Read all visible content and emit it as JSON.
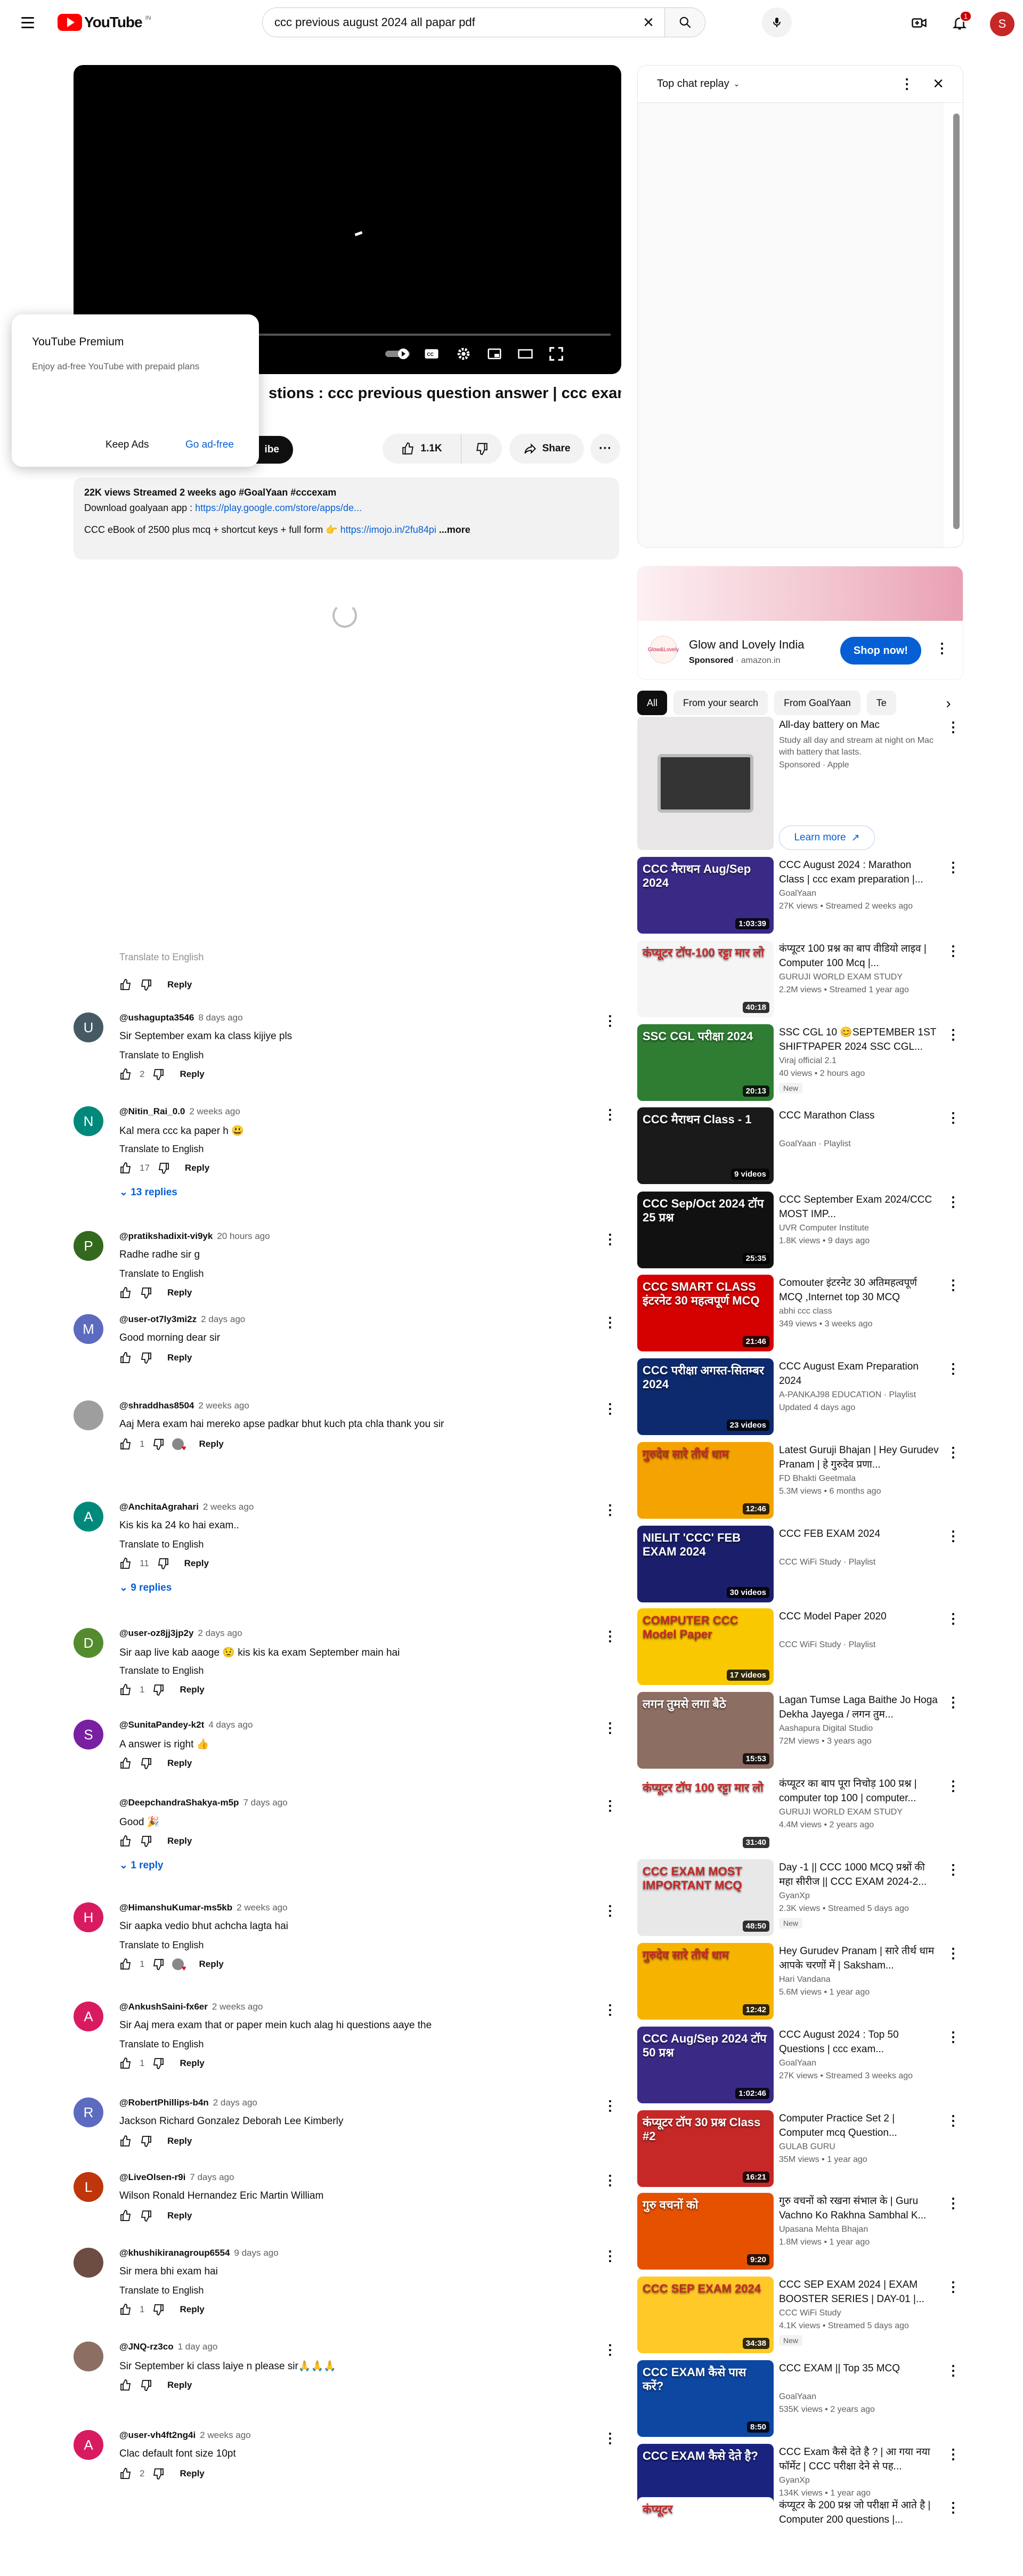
{
  "header": {
    "logo_text": "YouTube",
    "country": "IN",
    "search_value": "ccc previous august 2024 all papar pdf",
    "notification_count": "1",
    "avatar_letter": "S"
  },
  "premium": {
    "title": "YouTube Premium",
    "text": "Enjoy ad-free YouTube with prepaid plans",
    "keep": "Keep Ads",
    "go": "Go ad-free"
  },
  "video": {
    "title": "stions : ccc previous question answer | ccc exam",
    "subscribe": "ibe",
    "likes": "1.1K",
    "share": "Share",
    "desc_meta": "22K views  Streamed 2 weeks ago ",
    "desc_tags": "#GoalYaan #cccexam",
    "desc_line2_prefix": "Download goalyaan app : ",
    "desc_link1": "https://play.google.com/store/apps/de...",
    "desc_line3_prefix": "CCC eBook of 2500 plus mcq + shortcut keys + full form 👉 ",
    "desc_link2": "https://imojo.in/2fu84pi",
    "desc_more": "...more"
  },
  "chat": {
    "title": "Top chat replay"
  },
  "ad": {
    "title": "Glow and Lovely India",
    "sponsored": "Sponsored",
    "domain": "amazon.in",
    "shop": "Shop now!",
    "logo": "Glow&Lovely"
  },
  "chips": [
    "All",
    "From your search",
    "From GoalYaan",
    "Te"
  ],
  "recs": [
    {
      "title": "All-day battery on Mac",
      "channel": "Study all day and stream at night on Mac with battery that lasts.",
      "meta": "Sponsored · Apple",
      "duration": "",
      "thumb": "",
      "bg": "#e8e6e6",
      "learn": "Learn more"
    },
    {
      "title": "CCC August 2024 : Marathon Class | ccc exam preparation |...",
      "channel": "GoalYaan",
      "meta": "27K views • Streamed 2 weeks ago",
      "duration": "1:03:39",
      "thumb": "CCC मैराथन Aug/Sep 2024",
      "bg": "#3a2a86"
    },
    {
      "title": "कंप्यूटर 100 प्रश्न का बाप वीडियो लाइव | Computer 100 Mcq |...",
      "channel": "GURUJI WORLD EXAM STUDY",
      "meta": "2.2M views • Streamed 1 year ago",
      "duration": "40:18",
      "thumb": "कंप्यूटर टॉप-100 रट्टा मार लो",
      "bg": "#f5f5f5"
    },
    {
      "title": "SSC CGL 10 😊SEPTEMBER 1ST SHIFTPAPER 2024 SSC CGL...",
      "channel": "Viraj official 2.1",
      "meta": "40 views • 2 hours ago",
      "duration": "20:13",
      "thumb": "SSC CGL परीक्षा 2024",
      "bg": "#2e7d32",
      "new": "New"
    },
    {
      "title": "CCC Marathon Class",
      "channel": "GoalYaan · Playlist",
      "meta": "",
      "duration": "9 videos",
      "thumb": "CCC मैराथन Class - 1",
      "bg": "#1a1a1a"
    },
    {
      "title": "CCC September Exam 2024/CCC MOST IMP...",
      "channel": "UVR Computer Institute",
      "meta": "1.8K views • 9 days ago",
      "duration": "25:35",
      "thumb": "CCC Sep/Oct 2024 टॉप 25 प्रश्न",
      "bg": "#111"
    },
    {
      "title": "Comouter इंटरनेट 30 अतिमहत्वपूर्ण MCQ ,Internet top 30 MCQ",
      "channel": "abhi ccc class",
      "meta": "349 views • 3 weeks ago",
      "duration": "21:46",
      "thumb": "CCC SMART CLASS इंटरनेट 30 महत्वपूर्ण MCQ",
      "bg": "#d50000"
    },
    {
      "title": "CCC August Exam Preparation 2024",
      "channel": "A-PANKAJ98 EDUCATION · Playlist",
      "meta": "Updated 4 days ago",
      "duration": "23 videos",
      "thumb": "CCC परीक्षा अगस्त-सितम्बर 2024",
      "bg": "#0d2a6e"
    },
    {
      "title": "Latest Guruji Bhajan | Hey Gurudev Pranam | हे गुरुदेव प्रणा...",
      "channel": "FD Bhakti Geetmala",
      "meta": "5.3M views • 6 months ago",
      "duration": "12:46",
      "thumb": "गुरुदेव सारे तीर्थ धाम",
      "bg": "#f4a300"
    },
    {
      "title": "CCC FEB EXAM 2024",
      "channel": "CCC WiFi Study · Playlist",
      "meta": "",
      "duration": "30 videos",
      "thumb": "NIELIT 'CCC' FEB EXAM 2024",
      "bg": "#1b1f6b"
    },
    {
      "title": "CCC Model Paper 2020",
      "channel": "CCC WiFi Study · Playlist",
      "meta": "",
      "duration": "17 videos",
      "thumb": "COMPUTER CCC Model Paper",
      "bg": "#f9c800"
    },
    {
      "title": "Lagan Tumse Laga Baithe Jo Hoga Dekha Jayega / लगन तुम...",
      "channel": "Aashapura Digital Studio",
      "meta": "72M views • 3 years ago",
      "duration": "15:53",
      "thumb": "लगन तुमसे लगा बैठे",
      "bg": "#8d6e63"
    },
    {
      "title": "कंप्यूटर का बाप पूरा निचोड़ 100 प्रश्न | computer top 100 | computer...",
      "channel": "GURUJI WORLD EXAM STUDY",
      "meta": "4.4M views • 2 years ago",
      "duration": "31:40",
      "thumb": "कंप्यूटर टॉप 100 रट्टा मार लो",
      "bg": "#ffffff"
    },
    {
      "title": "Day -1 || CCC 1000 MCQ प्रश्नों की महा सीरीज || CCC EXAM 2024-2...",
      "channel": "GyanXp",
      "meta": "2.3K views • Streamed 5 days ago",
      "duration": "48:50",
      "thumb": "CCC EXAM MOST IMPORTANT MCQ",
      "bg": "#e8e8e8",
      "new": "New"
    },
    {
      "title": "Hey Gurudev Pranam | सारे तीर्थ धाम आपके चरणों में | Saksham...",
      "channel": "Hari Vandana",
      "meta": "5.6M views • 1 year ago",
      "duration": "12:42",
      "thumb": "गुरुदेव सारे तीर्थ धाम",
      "bg": "#f6b400"
    },
    {
      "title": "CCC August 2024 : Top 50 Questions | ccc exam...",
      "channel": "GoalYaan",
      "meta": "27K views • Streamed 3 weeks ago",
      "duration": "1:02:46",
      "thumb": "CCC Aug/Sep 2024 टॉप 50 प्रश्न",
      "bg": "#3a2a86"
    },
    {
      "title": "Computer Practice Set 2 | Computer mcq Question...",
      "channel": "GULAB GURU",
      "meta": "35M views • 1 year ago",
      "duration": "16:21",
      "thumb": "कंप्यूटर टॉप 30 प्रश्न Class #2",
      "bg": "#c62828"
    },
    {
      "title": "गुरु वचनों को रखना संभाल के | Guru Vachno Ko Rakhna Sambhal K...",
      "channel": "Upasana Mehta Bhajan",
      "meta": "1.8M views • 1 year ago",
      "duration": "9:20",
      "thumb": "गुरु वचनों को",
      "bg": "#e65100"
    },
    {
      "title": "CCC SEP EXAM 2024 | EXAM BOOSTER SERIES | DAY-01 |...",
      "channel": "CCC WiFi Study",
      "meta": "4.1K views • Streamed 5 days ago",
      "duration": "34:38",
      "thumb": "CCC SEP EXAM 2024",
      "bg": "#ffca28",
      "new": "New"
    },
    {
      "title": "CCC EXAM || Top 35 MCQ",
      "channel": "GoalYaan",
      "meta": "535K views • 2 years ago",
      "duration": "8:50",
      "thumb": "CCC EXAM कैसे पास करें?",
      "bg": "#0d47a1"
    },
    {
      "title": "CCC Exam कैसे देते है ? | आ गया नया फॉर्मेट | CCC परीक्षा देने से पह...",
      "channel": "GyanXp",
      "meta": "134K views • 1 year ago",
      "duration": "13:34",
      "thumb": "CCC EXAM कैसे देते है?",
      "bg": "#1a237e"
    },
    {
      "title": "कंप्यूटर के 200 प्रश्न जो परीक्षा में आते है | Computer 200 questions |...",
      "channel": "",
      "meta": "",
      "duration": "",
      "thumb": "कंप्यूटर",
      "bg": "#ffffff"
    }
  ],
  "comments": [
    {
      "author": "",
      "time": "",
      "text": "",
      "translate": "Translate to English",
      "likes": "",
      "color": "#fff",
      "letter": "",
      "replies": "",
      "hearted": false
    },
    {
      "author": "@ushagupta3546",
      "time": "8 days ago",
      "text": "Sir September exam ka class kijiye pls",
      "translate": "Translate to English",
      "likes": "2",
      "color": "#455a64",
      "letter": "U",
      "replies": "",
      "hearted": false
    },
    {
      "author": "@Nitin_Rai_0.0",
      "time": "2 weeks ago",
      "text": "Kal mera ccc ka paper h 😃",
      "translate": "Translate to English",
      "likes": "17",
      "color": "#00897b",
      "letter": "N",
      "replies": "13 replies",
      "hearted": false
    },
    {
      "author": "@pratikshadixit-vi9yk",
      "time": "20 hours ago",
      "text": "Radhe radhe sir g",
      "translate": "Translate to English",
      "likes": "",
      "color": "#33691e",
      "letter": "P",
      "replies": "",
      "hearted": false
    },
    {
      "author": "@user-ot7ly3mi2z",
      "time": "2 days ago",
      "text": "Good morning dear sir",
      "translate": "",
      "likes": "",
      "color": "#5c6bc0",
      "letter": "M",
      "replies": "",
      "hearted": false
    },
    {
      "author": "@shraddhas8504",
      "time": "2 weeks ago",
      "text": "Aaj Mera exam hai mereko apse padkar bhut kuch pta chla thank you sir",
      "translate": "",
      "likes": "1",
      "color": "#9e9e9e",
      "letter": "",
      "replies": "",
      "hearted": true
    },
    {
      "author": "@AnchitaAgrahari",
      "time": "2 weeks ago",
      "text": "Kis kis ka 24 ko hai exam..",
      "translate": "Translate to English",
      "likes": "11",
      "color": "#00897b",
      "letter": "A",
      "replies": "9 replies",
      "hearted": false
    },
    {
      "author": "@user-oz8jj3jp2y",
      "time": "2 days ago",
      "text": "Sir aap live kab aaoge 😟 kis kis ka exam September main hai",
      "translate": "Translate to English",
      "likes": "1",
      "color": "#558b2f",
      "letter": "D",
      "replies": "",
      "hearted": false
    },
    {
      "author": "@SunitaPandey-k2t",
      "time": "4 days ago",
      "text": "A answer is right 👍",
      "translate": "",
      "likes": "",
      "color": "#7b1fa2",
      "letter": "S",
      "replies": "",
      "hearted": false
    },
    {
      "author": "@DeepchandraShakya-m5p",
      "time": "7 days ago",
      "text": "Good 🎉",
      "translate": "",
      "likes": "",
      "color": "#fff",
      "letter": "",
      "replies": "1 reply",
      "hearted": false
    },
    {
      "author": "@HimanshuKumar-ms5kb",
      "time": "2 weeks ago",
      "text": "Sir aapka vedio bhut achcha lagta hai",
      "translate": "Translate to English",
      "likes": "1",
      "color": "#d81b60",
      "letter": "H",
      "replies": "",
      "hearted": true
    },
    {
      "author": "@AnkushSaini-fx6er",
      "time": "2 weeks ago",
      "text": "Sir Aaj mera exam that or paper mein kuch alag hi questions aaye the",
      "translate": "Translate to English",
      "likes": "1",
      "color": "#d81b60",
      "letter": "A",
      "replies": "",
      "hearted": false
    },
    {
      "author": "@RobertPhillips-b4n",
      "time": "2 days ago",
      "text": "Jackson Richard Gonzalez Deborah Lee Kimberly",
      "translate": "",
      "likes": "",
      "color": "#5c6bc0",
      "letter": "R",
      "replies": "",
      "hearted": false
    },
    {
      "author": "@LiveOlsen-r9i",
      "time": "7 days ago",
      "text": "Wilson Ronald Hernandez Eric Martin William",
      "translate": "",
      "likes": "",
      "color": "#bf360c",
      "letter": "L",
      "replies": "",
      "hearted": false
    },
    {
      "author": "@khushikiranagroup6554",
      "time": "9 days ago",
      "text": "Sir mera bhi exam hai",
      "translate": "Translate to English",
      "likes": "1",
      "color": "#6d4c41",
      "letter": "",
      "replies": "",
      "hearted": false
    },
    {
      "author": "@JNQ-rz3co",
      "time": "1 day ago",
      "text": "Sir September ki class laiye n please sir🙏🙏🙏",
      "translate": "",
      "likes": "",
      "color": "#8d6e63",
      "letter": "",
      "replies": "",
      "hearted": false
    },
    {
      "author": "@user-vh4ft2ng4i",
      "time": "2 weeks ago",
      "text": "Clac default font size 10pt",
      "translate": "",
      "likes": "2",
      "color": "#d81b60",
      "letter": "A",
      "replies": "",
      "hearted": false
    }
  ],
  "labels": {
    "reply": "Reply"
  },
  "colors": {
    "accent": "#065fd4",
    "brand": "#ff0000"
  }
}
